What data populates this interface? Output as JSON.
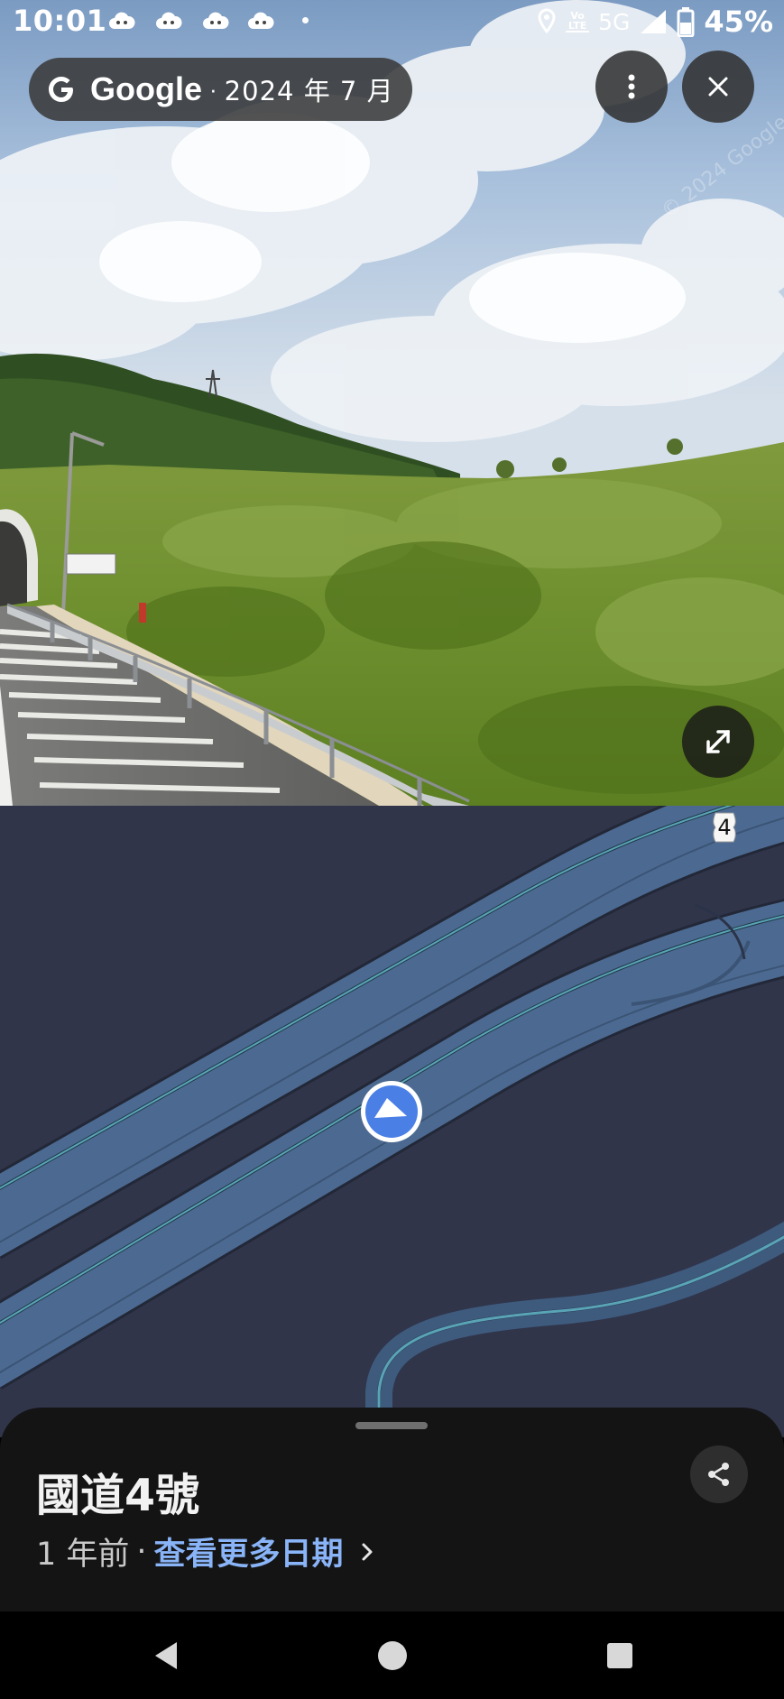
{
  "status_bar": {
    "time": "10:01",
    "network": "5G",
    "volte": "Vo LTE",
    "battery": "45%",
    "icons": [
      "cloud-icon",
      "cloud-icon",
      "cloud-icon",
      "cloud-icon",
      "location-icon",
      "signal-icon",
      "battery-icon"
    ]
  },
  "header": {
    "brand": "Google",
    "separator": "·",
    "date": "2024 年 7 月"
  },
  "photo": {
    "watermark": "© 2024 Google"
  },
  "map": {
    "route_number": "4"
  },
  "bottom_sheet": {
    "title": "國道4號",
    "time_ago": "1 年前",
    "separator": "·",
    "more_dates": "查看更多日期"
  },
  "colors": {
    "accent_link": "#8ab4f8",
    "marker_blue": "#4a7fe6",
    "map_background": "#30354a",
    "road_fill": "#4c6a91",
    "road_center_line": "#59a4b7"
  }
}
